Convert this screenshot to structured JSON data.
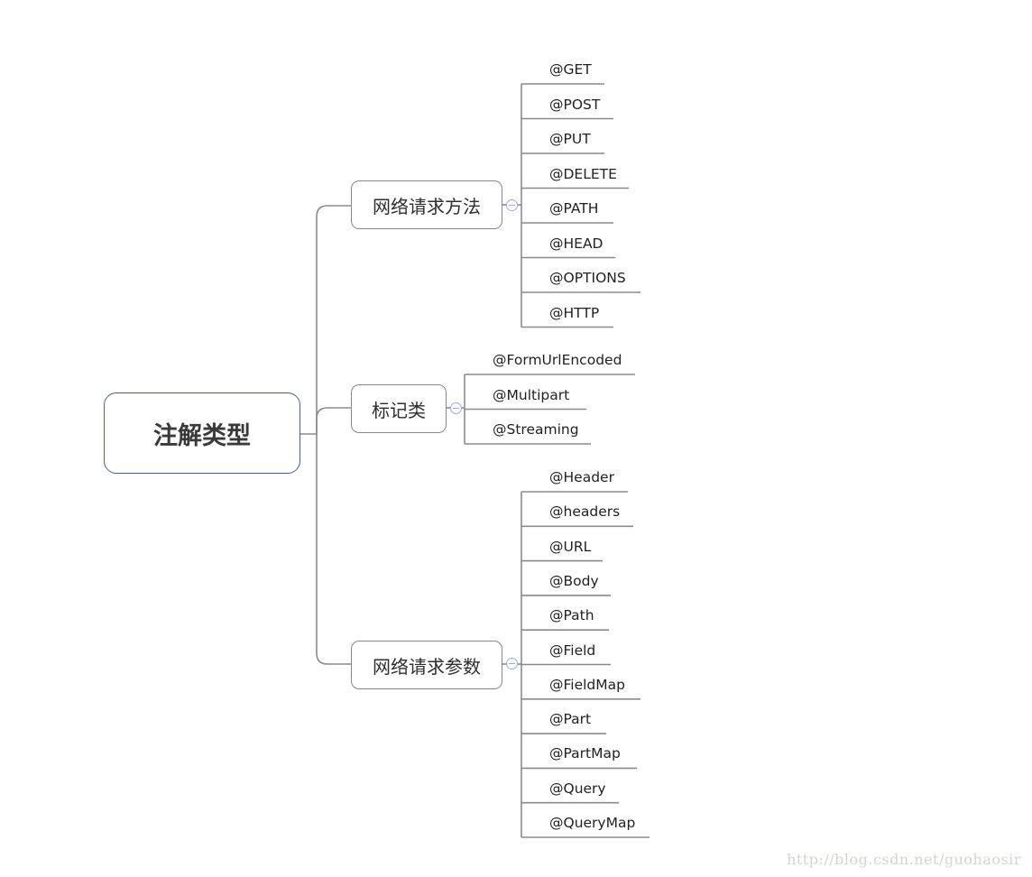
{
  "root": {
    "label": "注解类型"
  },
  "branches": [
    {
      "label": "网络请求方法",
      "items": [
        "@GET",
        "@POST",
        "@PUT",
        "@DELETE",
        "@PATH",
        "@HEAD",
        "@OPTIONS",
        "@HTTP"
      ]
    },
    {
      "label": "标记类",
      "items": [
        "@FormUrlEncoded",
        "@Multipart",
        "@Streaming"
      ]
    },
    {
      "label": "网络请求参数",
      "items": [
        "@Header",
        "@headers",
        "@URL",
        "@Body",
        "@Path",
        "@Field",
        "@FieldMap",
        "@Part",
        "@PartMap",
        "@Query",
        "@QueryMap"
      ]
    }
  ],
  "watermark": "http://blog.csdn.net/guohaosir",
  "colors": {
    "root_border": "#4d6185",
    "branch_border": "#8c8882",
    "line": "#8a8a8a",
    "collapse": "#98aee0"
  }
}
